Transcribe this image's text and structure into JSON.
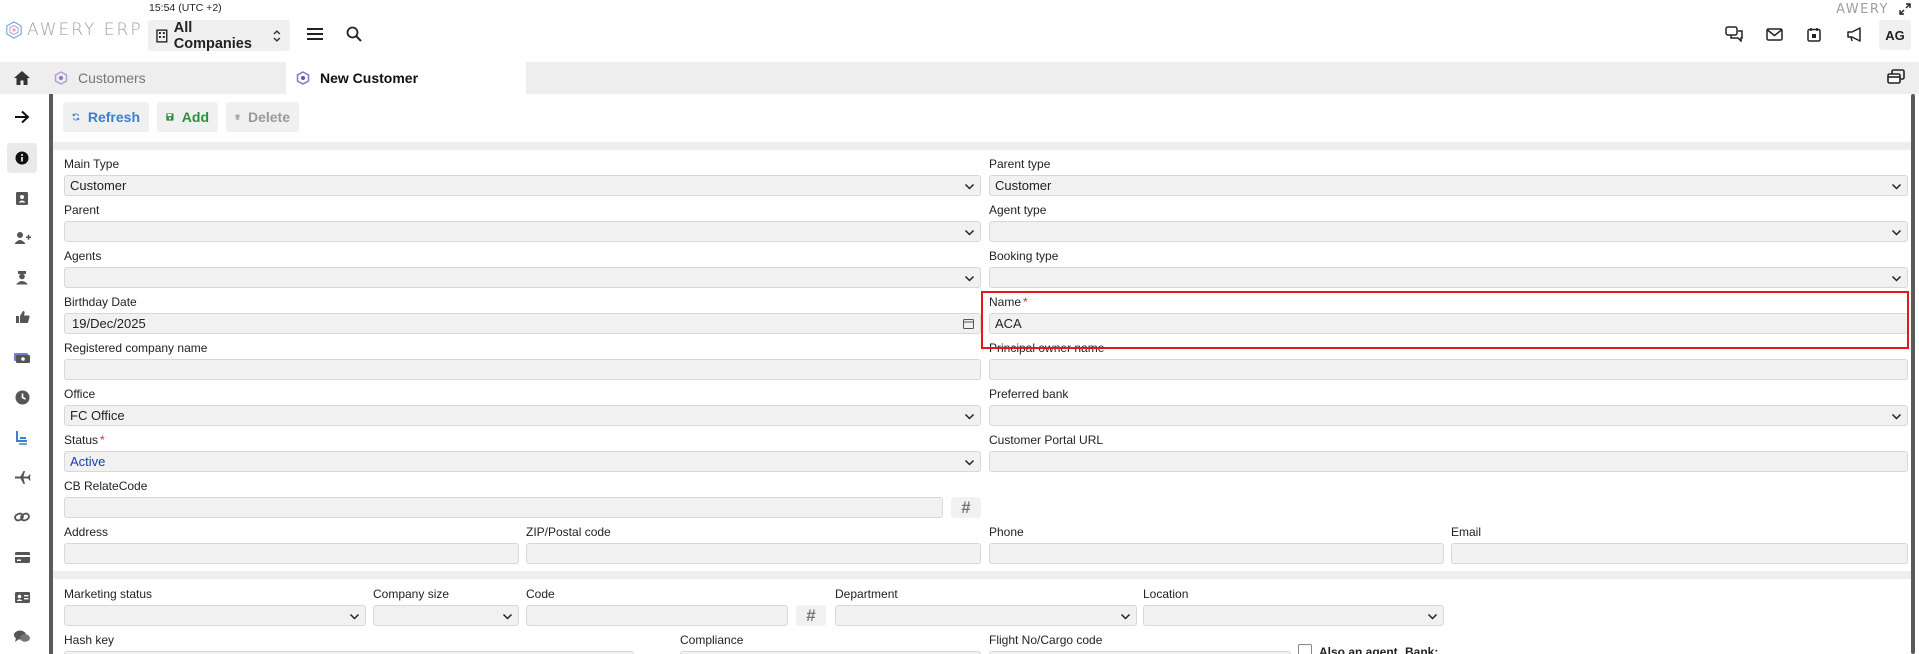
{
  "header": {
    "clock": "15:54 (UTC +2)",
    "logo_text": "AWERY ERP",
    "brand_right": "AWERY",
    "company_selector": "All Companies",
    "avatar": "AG",
    "icons": [
      "menu-icon",
      "search-icon",
      "chat-icon",
      "mail-icon",
      "calendar-icon",
      "megaphone-icon",
      "expand-icon"
    ]
  },
  "tabs": {
    "customers": "Customers",
    "new_customer": "New Customer"
  },
  "toolbar": {
    "refresh": "Refresh",
    "add": "Add",
    "delete": "Delete"
  },
  "sidebar": {
    "icons": [
      "arrow-right-icon",
      "info-icon",
      "contact-card-icon",
      "add-user-icon",
      "agent-icon",
      "thumbs-up-icon",
      "money-icon",
      "clock-icon",
      "seat-icon",
      "plane-icon",
      "link-icon",
      "card-icon",
      "id-card-icon",
      "comments-icon"
    ]
  },
  "form": {
    "main_type": {
      "label": "Main Type",
      "value": "Customer"
    },
    "parent_type": {
      "label": "Parent type",
      "value": "Customer"
    },
    "parent": {
      "label": "Parent",
      "value": ""
    },
    "agent_type": {
      "label": "Agent type",
      "value": ""
    },
    "agents": {
      "label": "Agents",
      "value": ""
    },
    "booking_type": {
      "label": "Booking type",
      "value": ""
    },
    "birthday_date": {
      "label": "Birthday Date",
      "value": "19/Dec/2025"
    },
    "name": {
      "label": "Name",
      "value": "ACA",
      "required": "*"
    },
    "registered_company_name": {
      "label": "Registered company name",
      "value": ""
    },
    "principal_owner_name": {
      "label": "Principal owner name",
      "value": ""
    },
    "office": {
      "label": "Office",
      "value": "FC Office"
    },
    "preferred_bank": {
      "label": "Preferred bank",
      "value": ""
    },
    "status": {
      "label": "Status",
      "value": "Active",
      "required": "*"
    },
    "customer_portal_url": {
      "label": "Customer Portal URL",
      "value": ""
    },
    "cb_relatecode": {
      "label": "CB RelateCode",
      "value": ""
    },
    "address": {
      "label": "Address",
      "value": ""
    },
    "zip": {
      "label": "ZIP/Postal code",
      "value": ""
    },
    "phone": {
      "label": "Phone",
      "value": ""
    },
    "email": {
      "label": "Email",
      "value": ""
    },
    "marketing_status": {
      "label": "Marketing status",
      "value": ""
    },
    "company_size": {
      "label": "Company size",
      "value": ""
    },
    "code": {
      "label": "Code",
      "value": ""
    },
    "department": {
      "label": "Department",
      "value": ""
    },
    "location": {
      "label": "Location",
      "value": ""
    },
    "hash_key": {
      "label": "Hash key"
    },
    "compliance": {
      "label": "Compliance"
    },
    "flight_no": {
      "label": "Flight No/Cargo code"
    },
    "also_an_agent": {
      "label": "Also an agent"
    },
    "bank": {
      "label": "Bank:"
    }
  },
  "colors": {
    "required": "#d32f2f",
    "highlight": "#e21a1a",
    "refresh": "#3d7ecf",
    "add": "#2e8f3f",
    "status_value": "#1a3fa8"
  }
}
